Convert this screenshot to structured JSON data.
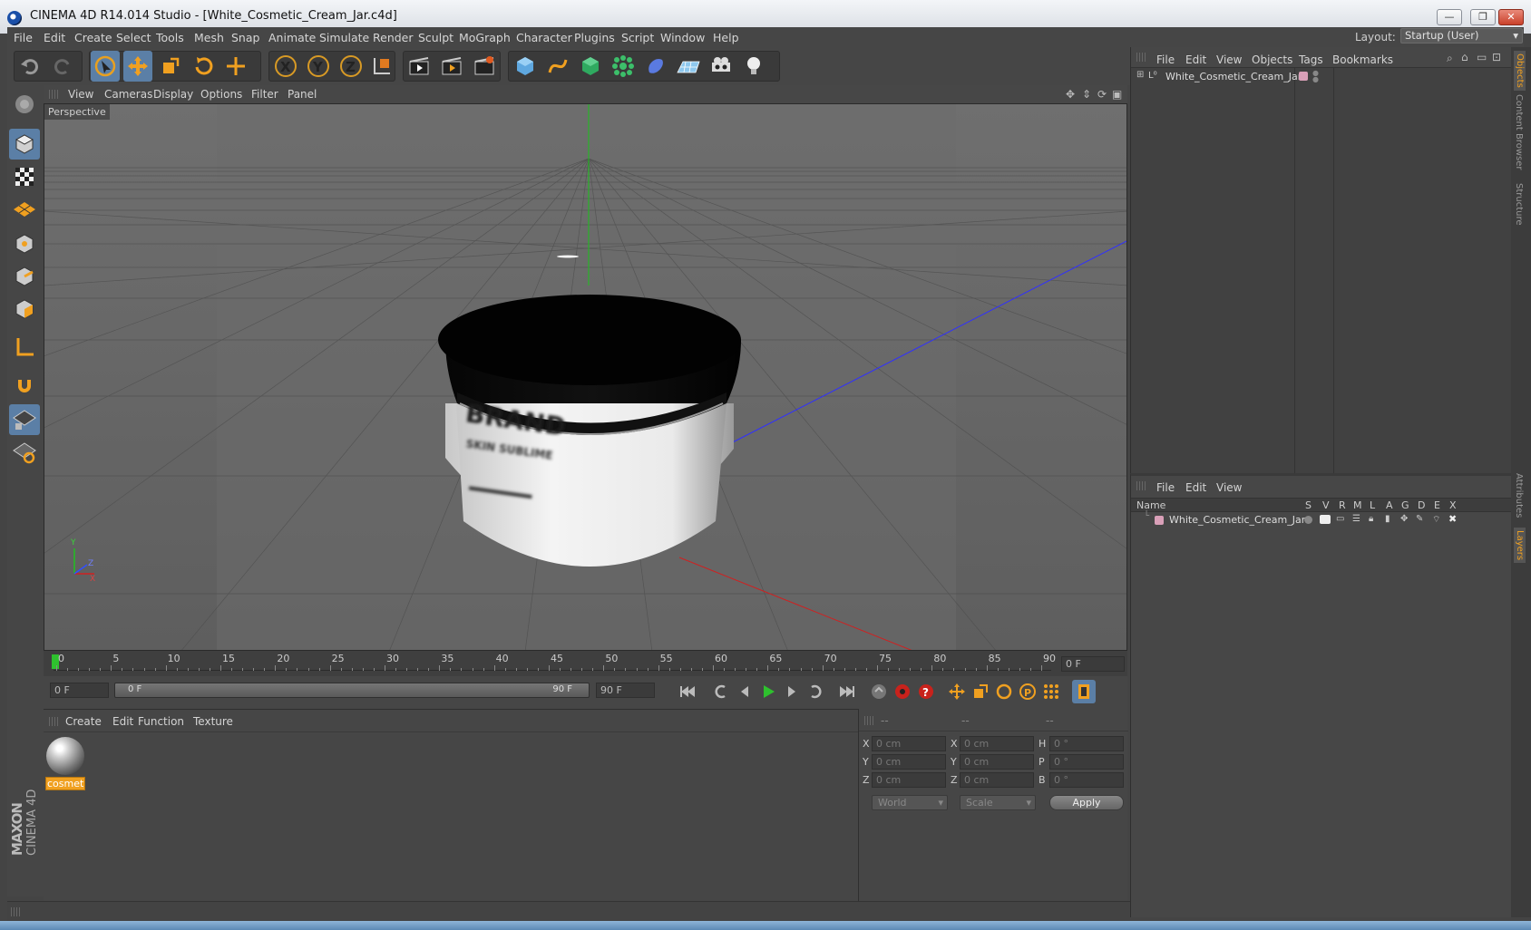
{
  "window": {
    "title": "CINEMA 4D R14.014 Studio - [White_Cosmetic_Cream_Jar.c4d]",
    "min": "—",
    "max": "❐",
    "close": "✕"
  },
  "menubar": {
    "items": [
      "File",
      "Edit",
      "Create",
      "Select",
      "Tools",
      "Mesh",
      "Snap",
      "Animate",
      "Simulate",
      "Render",
      "Sculpt",
      "MoGraph",
      "Character",
      "Plugins",
      "Script",
      "Window",
      "Help"
    ],
    "layout_label": "Layout:",
    "layout_value": "Startup (User)"
  },
  "viewport": {
    "menu": [
      "View",
      "Cameras",
      "Display",
      "Options",
      "Filter",
      "Panel"
    ],
    "label": "Perspective",
    "jar_label": {
      "brand": "BRAND",
      "sub": "SKIN SUBLIME"
    },
    "axis": {
      "y": "Y",
      "z": "Z",
      "x": "X"
    }
  },
  "timeline": {
    "ticks": [
      "0",
      "5",
      "10",
      "15",
      "20",
      "25",
      "30",
      "35",
      "40",
      "45",
      "50",
      "55",
      "60",
      "65",
      "70",
      "75",
      "80",
      "85",
      "90"
    ],
    "current": "0 F"
  },
  "transport": {
    "start": "0 F",
    "range_start": "0 F",
    "range_end": "90 F",
    "end": "90 F"
  },
  "material_manager": {
    "menu": [
      "Create",
      "Edit",
      "Function",
      "Texture"
    ],
    "material_name": "cosmetic"
  },
  "coordinates": {
    "headers": [
      "--",
      "--",
      "--"
    ],
    "rows": [
      {
        "a": "X",
        "pos": "0 cm",
        "b": "X",
        "size": "0 cm",
        "c": "H",
        "rot": "0 °"
      },
      {
        "a": "Y",
        "pos": "0 cm",
        "b": "Y",
        "size": "0 cm",
        "c": "P",
        "rot": "0 °"
      },
      {
        "a": "Z",
        "pos": "0 cm",
        "b": "Z",
        "size": "0 cm",
        "c": "B",
        "rot": "0 °"
      }
    ],
    "world": "World",
    "scale": "Scale",
    "apply": "Apply"
  },
  "object_manager": {
    "menu": [
      "File",
      "Edit",
      "View",
      "Objects",
      "Tags",
      "Bookmarks"
    ],
    "object": "White_Cosmetic_Cream_Jar"
  },
  "layer_manager": {
    "menu": [
      "File",
      "Edit",
      "View"
    ],
    "columns": [
      "Name",
      "S",
      "V",
      "R",
      "M",
      "L",
      "A",
      "G",
      "D",
      "E",
      "X"
    ],
    "layer": "White_Cosmetic_Cream_Jar"
  },
  "side_tabs": [
    "Objects",
    "Content Browser",
    "Structure",
    "Attributes",
    "Layers"
  ],
  "brand": {
    "maxon": "MAXON",
    "c4d": "CINEMA 4D"
  },
  "colors": {
    "accent": "#f0a020",
    "selection": "#5b7fa6"
  }
}
